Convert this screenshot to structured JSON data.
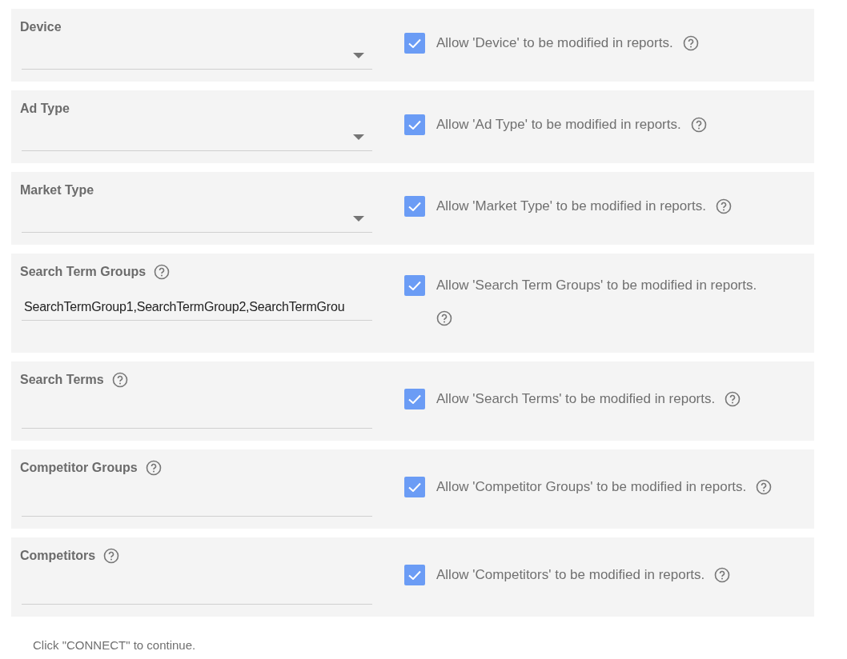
{
  "fields": [
    {
      "kind": "dropdown",
      "label": "Device",
      "help": false,
      "allow": {
        "checked": true,
        "text": "Allow 'Device' to be modified in reports."
      }
    },
    {
      "kind": "dropdown",
      "label": "Ad Type",
      "help": false,
      "allow": {
        "checked": true,
        "text": "Allow 'Ad Type' to be modified in reports."
      }
    },
    {
      "kind": "dropdown",
      "label": "Market Type",
      "help": false,
      "allow": {
        "checked": true,
        "text": "Allow 'Market Type' to be modified in reports."
      }
    },
    {
      "kind": "text",
      "label": "Search Term Groups",
      "help": true,
      "value": "SearchTermGroup1,SearchTermGroup2,SearchTermGrou",
      "allow": {
        "checked": true,
        "text": "Allow 'Search Term Groups' to be modified in reports."
      }
    },
    {
      "kind": "text",
      "label": "Search Terms",
      "help": true,
      "allow": {
        "checked": true,
        "text": "Allow 'Search Terms' to be modified in reports."
      }
    },
    {
      "kind": "text",
      "label": "Competitor Groups",
      "help": true,
      "allow": {
        "checked": true,
        "text": "Allow 'Competitor Groups' to be modified in reports."
      }
    },
    {
      "kind": "text",
      "label": "Competitors",
      "help": true,
      "allow": {
        "checked": true,
        "text": "Allow 'Competitors' to be modified in reports."
      }
    }
  ],
  "footer": "Click \"CONNECT\" to continue."
}
